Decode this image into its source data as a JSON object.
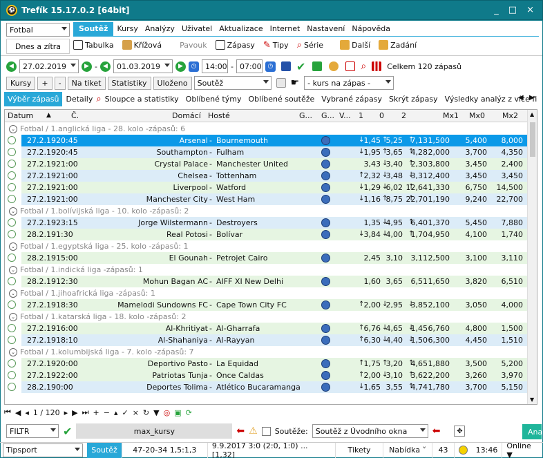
{
  "window": {
    "title": "Trefík 15.17.0.2 [64bit]",
    "min": "_",
    "max": "□",
    "close": "×"
  },
  "sport_select": "Fotbal",
  "period_button": "Dnes a zítra",
  "menu": [
    "Soutěž",
    "Kursy",
    "Analýzy",
    "Uživatel",
    "Aktualizace",
    "Internet",
    "Nastavení",
    "Nápověda"
  ],
  "ribbon": {
    "tabulka": "Tabulka",
    "krizova": "Křížová",
    "pavouk": "Pavouk",
    "zapasy": "Zápasy",
    "tipy": "Tipy",
    "serie": "Série",
    "dalsi": "Další",
    "zadani": "Zadání"
  },
  "dates": {
    "from": "27.02.2019",
    "to": "01.03.2019",
    "sep": "-",
    "time_from": "14:00",
    "time_sep": "-",
    "time_to": "07:00",
    "total": "Celkem 120 zápasů"
  },
  "toolbar2": {
    "kursy": "Kursy",
    "plus": "+",
    "minus": "-",
    "na_tiket": "Na tiket",
    "statistiky": "Statistiky",
    "ulozeno": "Uloženo",
    "soutez": "Soutěž",
    "kurs": "- kurs na zápas -"
  },
  "tabs": [
    "Výběr zápasů",
    "Detaily",
    "Sloupce a statistiky",
    "Oblíbené týmy",
    "Oblíbené soutěže",
    "Vybrané zápasy",
    "Skrýt zápasy",
    "Výsledky analýz z více fi"
  ],
  "columns": {
    "datum": "Datum",
    "c": "Č.",
    "domaci": "Domácí",
    "hoste": "Hosté",
    "g1": "G...",
    "g2": "G...",
    "v": "V...",
    "k1": "1",
    "k0": "0",
    "k2": "2",
    "mx1": "Mx1",
    "mx0": "Mx0",
    "mx2": "Mx2"
  },
  "groups": [
    {
      "label": "Fotbal / 1.anglická liga - 28. kolo -zápasů: 6",
      "rows": [
        {
          "date": "27.2.19",
          "time": "20:45",
          "home": "Arsenal",
          "away": "Bournemouth",
          "a1": "↓",
          "k1": "1,45",
          "a0": "↑",
          "k0": "5,25",
          "a2": "↑",
          "k2": "7,13",
          "mx1": "1,500",
          "mx0": "5,400",
          "mx2": "8,000",
          "style": "sel"
        },
        {
          "date": "27.2.19",
          "time": "20:45",
          "home": "Southampton",
          "away": "Fulham",
          "a1": "↓",
          "k1": "1,95",
          "a0": "↑",
          "k0": "3,65",
          "a2": "↑",
          "k2": "4,28",
          "mx1": "2,000",
          "mx0": "3,700",
          "mx2": "4,350",
          "style": "b"
        },
        {
          "date": "27.2.19",
          "time": "21:00",
          "home": "Crystal Palace",
          "away": "Manchester United",
          "a1": "",
          "k1": "3,43",
          "a0": "↓",
          "k0": "3,40",
          "a2": "↑",
          "k2": "2,30",
          "mx1": "3,800",
          "mx0": "3,450",
          "mx2": "2,400",
          "style": "g"
        },
        {
          "date": "27.2.19",
          "time": "21:00",
          "home": "Chelsea",
          "away": "Tottenham",
          "a1": "↑",
          "k1": "2,32",
          "a0": "↓",
          "k0": "3,48",
          "a2": "↓",
          "k2": "3,31",
          "mx1": "2,400",
          "mx0": "3,450",
          "mx2": "3,450",
          "style": "b"
        },
        {
          "date": "27.2.19",
          "time": "21:00",
          "home": "Liverpool",
          "away": "Watford",
          "a1": "↓",
          "k1": "1,29",
          "a0": "↓",
          "k0": "6,02",
          "a2": "↑",
          "k2": "12,64",
          "mx1": "1,330",
          "mx0": "6,750",
          "mx2": "14,500",
          "style": "g"
        },
        {
          "date": "27.2.19",
          "time": "21:00",
          "home": "Manchester City",
          "away": "West Ham",
          "a1": "↓",
          "k1": "1,16",
          "a0": "↑",
          "k0": "8,75",
          "a2": "↑",
          "k2": "22,70",
          "mx1": "1,190",
          "mx0": "9,240",
          "mx2": "22,700",
          "style": "b"
        }
      ]
    },
    {
      "label": "Fotbal / 1.bolívijská liga - 10. kolo -zápasů: 2",
      "rows": [
        {
          "date": "27.2.19",
          "time": "23:15",
          "home": "Jorge Wilstermann",
          "away": "Destroyers",
          "a1": "",
          "k1": "1,35",
          "a0": "↓",
          "k0": "4,95",
          "a2": "↑",
          "k2": "6,40",
          "mx1": "1,370",
          "mx0": "5,450",
          "mx2": "7,880",
          "style": "b"
        },
        {
          "date": "28.2.19",
          "time": "1:30",
          "home": "Real Potosi",
          "away": "Bolívar",
          "a1": "↓",
          "k1": "3,84",
          "a0": "↓",
          "k0": "4,00",
          "a2": "↑",
          "k2": "1,70",
          "mx1": "4,950",
          "mx0": "4,100",
          "mx2": "1,740",
          "style": "g"
        }
      ]
    },
    {
      "label": "Fotbal / 1.egyptská liga - 25. kolo -zápasů: 1",
      "rows": [
        {
          "date": "28.2.19",
          "time": "15:00",
          "home": "El Gounah",
          "away": "Petrojet Cairo",
          "a1": "",
          "k1": "2,45",
          "a0": "",
          "k0": "3,10",
          "a2": "",
          "k2": "3,11",
          "mx1": "2,500",
          "mx0": "3,100",
          "mx2": "3,110",
          "style": "g"
        }
      ]
    },
    {
      "label": "Fotbal / 1.indická liga -zápasů: 1",
      "rows": [
        {
          "date": "28.2.19",
          "time": "12:30",
          "home": "Mohun Bagan AC",
          "away": "AIFF XI New Delhi",
          "a1": "",
          "k1": "1,60",
          "a0": "",
          "k0": "3,65",
          "a2": "",
          "k2": "6,51",
          "mx1": "1,650",
          "mx0": "3,820",
          "mx2": "6,510",
          "style": "g"
        }
      ]
    },
    {
      "label": "Fotbal / 1.jihoafrická liga -zápasů: 1",
      "rows": [
        {
          "date": "27.2.19",
          "time": "18:30",
          "home": "Mamelodi Sundowns FC",
          "away": "Cape Town City FC",
          "a1": "↑",
          "k1": "2,00",
          "a0": "↓",
          "k0": "2,95",
          "a2": "↓",
          "k2": "3,85",
          "mx1": "2,100",
          "mx0": "3,050",
          "mx2": "4,000",
          "style": "g"
        }
      ]
    },
    {
      "label": "Fotbal / 1.katarská liga - 18. kolo -zápasů: 2",
      "rows": [
        {
          "date": "27.2.19",
          "time": "16:00",
          "home": "Al-Khritiyat",
          "away": "Al-Gharrafa",
          "a1": "↑",
          "k1": "6,76",
          "a0": "↓",
          "k0": "4,65",
          "a2": "↓",
          "k2": "1,45",
          "mx1": "6,760",
          "mx0": "4,800",
          "mx2": "1,500",
          "style": "g"
        },
        {
          "date": "27.2.19",
          "time": "18:10",
          "home": "Al-Shahaniya",
          "away": "Al-Rayyan",
          "a1": "↑",
          "k1": "6,30",
          "a0": "↓",
          "k0": "4,40",
          "a2": "↓",
          "k2": "1,50",
          "mx1": "6,300",
          "mx0": "4,450",
          "mx2": "1,510",
          "style": "b"
        }
      ]
    },
    {
      "label": "Fotbal / 1.kolumbijská liga - 7. kolo -zápasů: 7",
      "rows": [
        {
          "date": "27.2.19",
          "time": "20:00",
          "home": "Deportivo Pasto",
          "away": "La Equidad",
          "a1": "↑",
          "k1": "1,75",
          "a0": "↑",
          "k0": "3,20",
          "a2": "↑",
          "k2": "4,65",
          "mx1": "1,880",
          "mx0": "3,500",
          "mx2": "5,200",
          "style": "g"
        },
        {
          "date": "27.2.19",
          "time": "22:00",
          "home": "Patriotas Tunja",
          "away": "Once Caldas",
          "a1": "↑",
          "k1": "2,00",
          "a0": "↓",
          "k0": "3,10",
          "a2": "↑",
          "k2": "3,62",
          "mx1": "2,200",
          "mx0": "3,260",
          "mx2": "3,970",
          "style": "g"
        },
        {
          "date": "28.2.19",
          "time": "0:00",
          "home": "Deportes Tolima",
          "away": "Atlético Bucaramanga",
          "a1": "↓",
          "k1": "1,65",
          "a0": "",
          "k0": "3,55",
          "a2": "↑",
          "k2": "4,74",
          "mx1": "1,780",
          "mx0": "3,700",
          "mx2": "5,150",
          "style": "b"
        }
      ]
    }
  ],
  "nav": {
    "page": "1 / 120"
  },
  "filter": {
    "label": "FILTR",
    "name": "max_kursy",
    "soutez_label": "Soutěže:",
    "soutez_select": "Soutěž z Úvodního okna",
    "right_btn": "Ana"
  },
  "status": {
    "tipsport": "Tipsport",
    "soutez": "Soutěž",
    "score": "47-20-34  1,5:1,3",
    "date": "9.9.2017 3:0 (2:0, 1:0) ... [1,32]",
    "tikety": "Tikety",
    "nabidka": "Nabídka ˅",
    "count": "43",
    "time": "13:46",
    "online": "Online ▼"
  }
}
